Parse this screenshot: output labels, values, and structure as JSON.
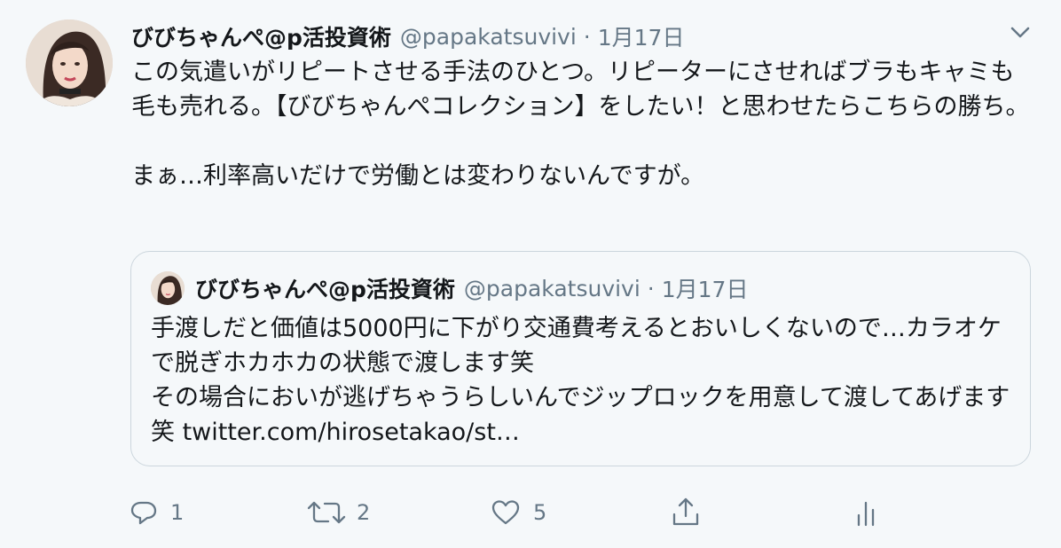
{
  "tweet": {
    "author_name": "びびちゃんぺ@p活投資術",
    "author_handle": "@papakatsuvivi",
    "separator": "·",
    "date": "1月17日",
    "text_lines": [
      "この気遣いがリピートさせる手法のひとつ。リピーターにさせればブラもキャミも毛も売れる。【びびちゃんぺコレクション】をしたい！と思わせたらこちらの勝ち。",
      "まぁ…利率高いだけで労働とは変わりないんですが。"
    ]
  },
  "quoted_tweet": {
    "author_name": "びびちゃんぺ@p活投資術",
    "author_handle": "@papakatsuvivi",
    "separator": "·",
    "date": "1月17日",
    "text_lines": [
      "手渡しだと価値は5000円に下がり交通費考えるとおいしくないので…カラオケで脱ぎホカホカの状態で渡します笑",
      "その場合においが逃げちゃうらしいんでジップロックを用意して渡してあげます笑 twitter.com/hirosetakao/st…"
    ]
  },
  "actions": {
    "reply": {
      "icon": "reply-icon",
      "count": "1"
    },
    "retweet": {
      "icon": "retweet-icon",
      "count": "2"
    },
    "like": {
      "icon": "heart-icon",
      "count": "5"
    },
    "share": {
      "icon": "share-icon"
    },
    "analytics": {
      "icon": "analytics-icon"
    }
  },
  "colors": {
    "background": "#f5f8fa",
    "text_primary": "#14171a",
    "text_secondary": "#657786",
    "border": "#ccd6dd"
  }
}
